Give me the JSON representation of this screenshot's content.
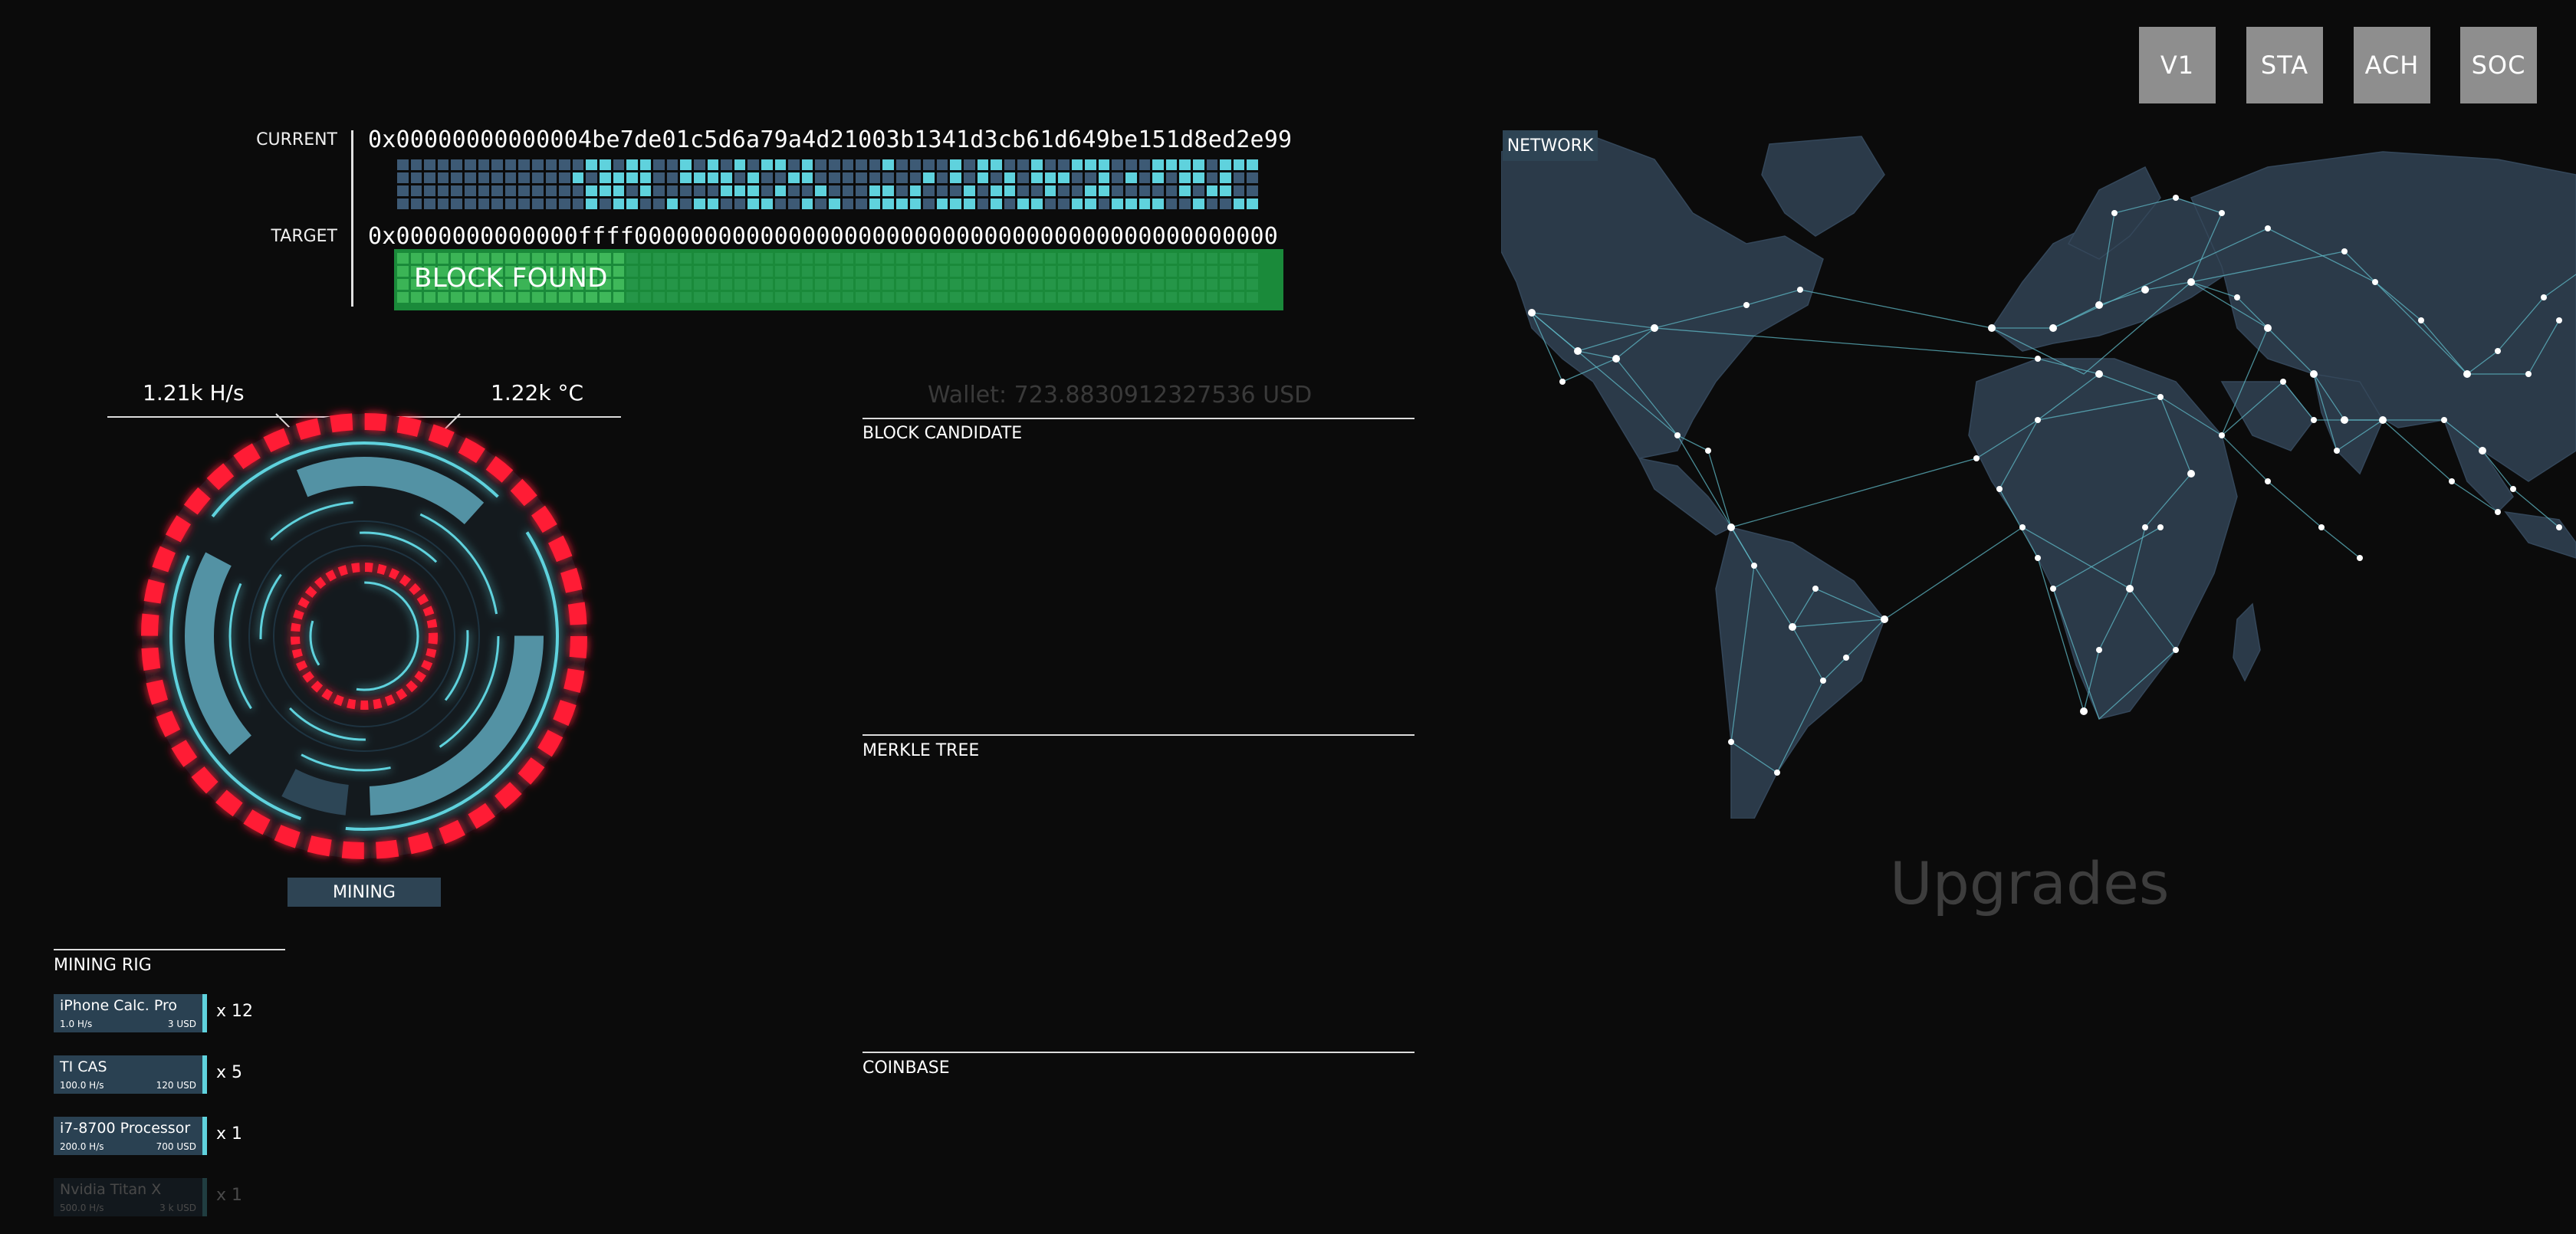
{
  "nav": [
    "V1",
    "STA",
    "ACH",
    "SOC"
  ],
  "hash": {
    "current_label": "CURRENT",
    "current_value": "0x00000000000004be7de01c5d6a79a4d21003b1341d3cb61d649be151d8ed2e99",
    "target_label": "TARGET",
    "target_value": "0x0000000000000ffff0000000000000000000000000000000000000000000000",
    "found_label": "BLOCK FOUND"
  },
  "gauge": {
    "hashrate": "1.21k H/s",
    "temperature": "1.22k °C",
    "mode_button": "MINING"
  },
  "wallet": "Wallet: 723.8830912327536 USD",
  "sections": {
    "block_candidate": "BLOCK CANDIDATE",
    "merkle_tree": "MERKLE TREE",
    "coinbase": "COINBASE",
    "mining_rig": "MINING RIG",
    "network": "NETWORK",
    "upgrades": "Upgrades"
  },
  "rigs": [
    {
      "name": "iPhone Calc. Pro",
      "rate": "1.0 H/s",
      "price": "3 USD",
      "count": "x 12",
      "enabled": true
    },
    {
      "name": "TI CAS",
      "rate": "100.0 H/s",
      "price": "120 USD",
      "count": "x 5",
      "enabled": true
    },
    {
      "name": "i7-8700 Processor",
      "rate": "200.0 H/s",
      "price": "700 USD",
      "count": "x 1",
      "enabled": true
    },
    {
      "name": "Nvidia Titan X",
      "rate": "500.0 H/s",
      "price": "3 k USD",
      "count": "x 1",
      "enabled": false
    }
  ],
  "colors": {
    "accent_cyan": "#5fd2dd",
    "cell_dim": "#3d5a75",
    "found_green": "#1a8a3a",
    "ring_red": "#ff1a35",
    "panel": "#2e4454"
  }
}
